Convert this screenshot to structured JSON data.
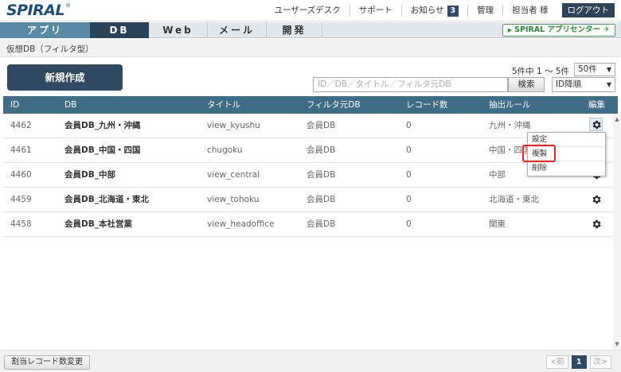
{
  "header": {
    "logo": "SPIRAL",
    "logo_mark": "®",
    "links": [
      "ユーザーズデスク",
      "サポート",
      "お知らせ",
      "管理",
      "担当者 様"
    ],
    "notice_count": "3",
    "logout": "ログアウト"
  },
  "nav": {
    "tabs": [
      "アプリ",
      "DB",
      "Web",
      "メール",
      "開発"
    ],
    "active_tab": "DB",
    "app_center": "SPIRAL アプリセンター"
  },
  "breadcrumb": "仮想DB（フィルタ型）",
  "toolbar": {
    "new_button": "新規作成",
    "count_info": "5件中 1 ～ 5件",
    "per_page": "50件",
    "search_placeholder": "ID／DB／タイトル／フィルタ元DB",
    "search_button": "検索",
    "sort": "ID降順"
  },
  "table": {
    "headers": [
      "ID",
      "DB",
      "タイトル",
      "フィルタ元DB",
      "レコード数",
      "抽出ルール",
      "編集"
    ],
    "rows": [
      {
        "id": "4462",
        "db": "会員DB_九州・沖縄",
        "title": "view_kyushu",
        "source": "会員DB",
        "records": "0",
        "rule": "九州・沖縄"
      },
      {
        "id": "4461",
        "db": "会員DB_中国・四国",
        "title": "chugoku",
        "source": "会員DB",
        "records": "0",
        "rule": "中国・四国"
      },
      {
        "id": "4460",
        "db": "会員DB_中部",
        "title": "view_central",
        "source": "会員DB",
        "records": "0",
        "rule": "中部"
      },
      {
        "id": "4459",
        "db": "会員DB_北海道・東北",
        "title": "view_tohoku",
        "source": "会員DB",
        "records": "0",
        "rule": "北海道・東北"
      },
      {
        "id": "4458",
        "db": "会員DB_本社営業",
        "title": "view_headoffice",
        "source": "会員DB",
        "records": "0",
        "rule": "関東"
      }
    ]
  },
  "menu": {
    "items": [
      "設定",
      "複製",
      "削除"
    ],
    "highlighted": "複製"
  },
  "footer": {
    "alloc_button": "割当レコード数変更",
    "prev": "<前",
    "page": "1",
    "next": "次>"
  },
  "icons": {
    "gear": "gear-icon",
    "dropdown_arrow": "triangle-down",
    "scroll_up": "triangle-up",
    "scroll_down": "triangle-down",
    "app_center_arrow": "triangle-right"
  },
  "colors": {
    "brand": "#1d4e79",
    "table_header": "#3f6d87",
    "new_button": "#2f4a60",
    "highlight": "#e22222",
    "app_center_green": "#2c8a3a"
  }
}
